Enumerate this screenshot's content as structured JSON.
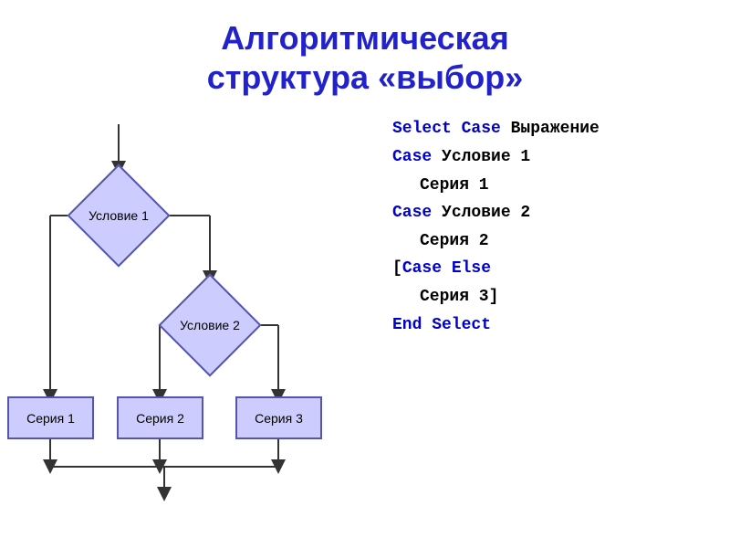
{
  "title": {
    "line1": "Алгоритмическая",
    "line2": "структура «выбор»"
  },
  "flowchart": {
    "diamond1_label": "Условие 1",
    "diamond2_label": "Условие 2",
    "rect1_label": "Серия 1",
    "rect2_label": "Серия 2",
    "rect3_label": "Серия 3"
  },
  "code": {
    "line1_kw": "Select Case",
    "line1_rest": " Выражение",
    "line2_kw": "Case",
    "line2_rest": " Условие 1",
    "line3": "Серия 1",
    "line4_kw": "Case",
    "line4_rest": " Условие 2",
    "line5": "Серия 2",
    "line6": "[",
    "line6_kw": "Case Else",
    "line7": "Серия 3]",
    "line8_kw": "End Select"
  }
}
